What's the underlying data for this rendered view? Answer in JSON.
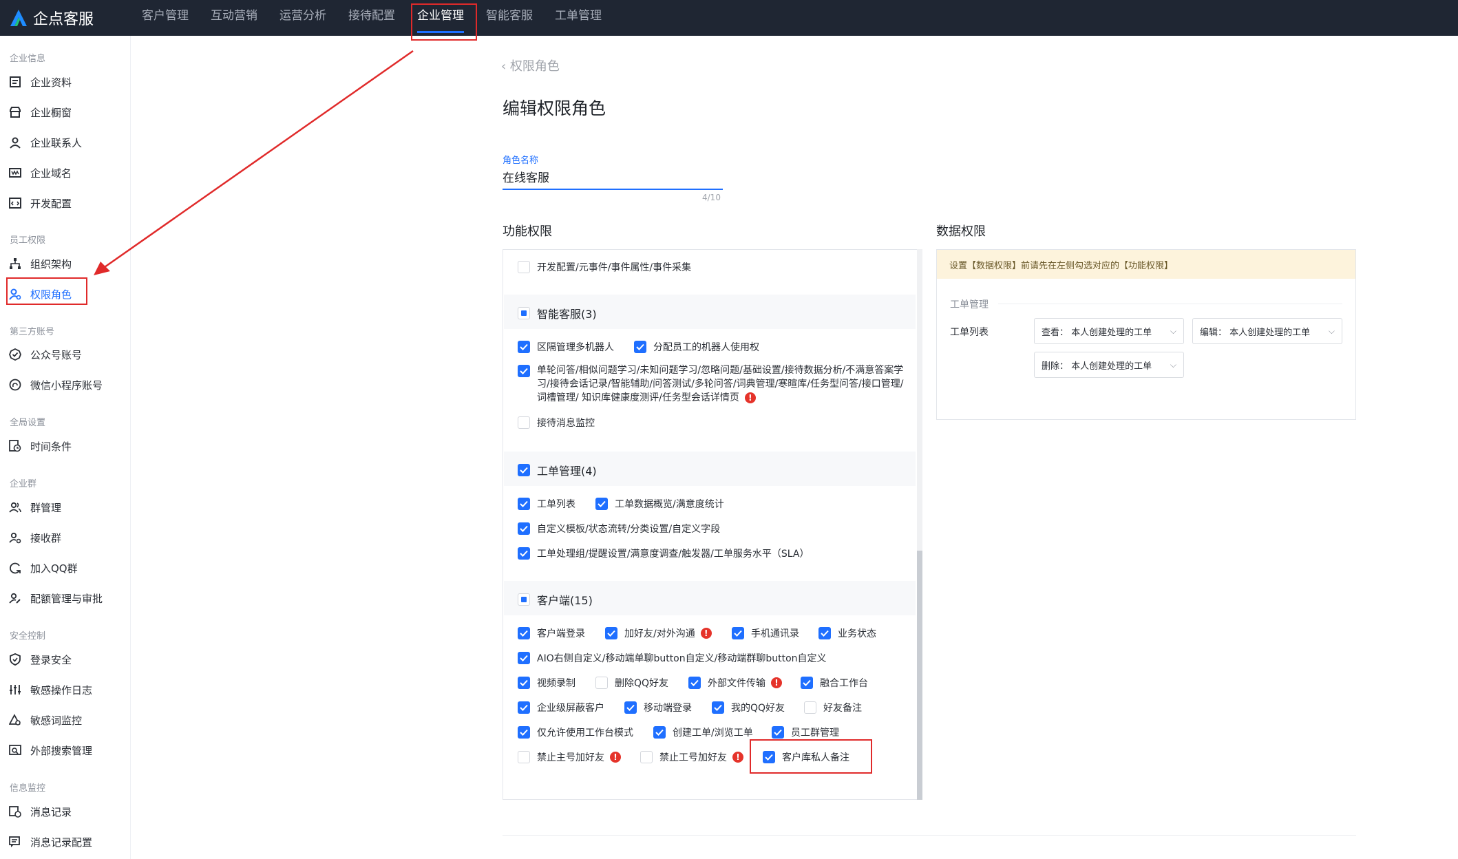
{
  "app": {
    "logo_text": "企点客服"
  },
  "nav": {
    "items": [
      "客户管理",
      "互动营销",
      "运营分析",
      "接待配置",
      "企业管理",
      "智能客服",
      "工单管理"
    ],
    "active_index": 4
  },
  "sidebar": {
    "groups": [
      {
        "title": "企业信息",
        "items": [
          "企业资料",
          "企业橱窗",
          "企业联系人",
          "企业域名",
          "开发配置"
        ]
      },
      {
        "title": "员工权限",
        "items": [
          "组织架构",
          "权限角色"
        ]
      },
      {
        "title": "第三方账号",
        "items": [
          "公众号账号",
          "微信小程序账号"
        ]
      },
      {
        "title": "全局设置",
        "items": [
          "时间条件"
        ]
      },
      {
        "title": "企业群",
        "items": [
          "群管理",
          "接收群",
          "加入QQ群",
          "配额管理与审批"
        ]
      },
      {
        "title": "安全控制",
        "items": [
          "登录安全",
          "敏感操作日志",
          "敏感词监控",
          "外部搜索管理"
        ]
      },
      {
        "title": "信息监控",
        "items": [
          "消息记录",
          "消息记录配置"
        ]
      }
    ],
    "active": "权限角色"
  },
  "page": {
    "back": "权限角色",
    "title": "编辑权限角色",
    "role_label": "角色名称",
    "role_value": "在线客服",
    "role_count": "4/10"
  },
  "func": {
    "title": "功能权限",
    "dev_item": "开发配置/元事件/事件属性/事件采集",
    "g1": {
      "label": "智能客服(3)",
      "items": [
        "区隔管理多机器人",
        "分配员工的机器人使用权"
      ],
      "long_text": "单轮问答/相似问题学习/未知问题学习/忽略问题/基础设置/接待数据分析/不满意答案学习/接待会话记录/智能辅助/问答测试/多轮问答/词典管理/寒暄库/任务型问答/接口管理/词槽管理/ 知识库健康度测评/任务型会话详情页",
      "monitor": "接待消息监控"
    },
    "g2": {
      "label": "工单管理(4)",
      "items": [
        "工单列表",
        "工单数据概览/满意度统计",
        "自定义模板/状态流转/分类设置/自定义字段",
        "工单处理组/提醒设置/满意度调查/触发器/工单服务水平（SLA）"
      ]
    },
    "g3": {
      "label": "客户端(15)",
      "items": [
        "客户端登录",
        "加好友/对外沟通",
        "手机通讯录",
        "业务状态",
        "AIO右侧自定义/移动端单聊button自定义/移动端群聊button自定义",
        "视频录制",
        "删除QQ好友",
        "外部文件传输",
        "融合工作台",
        "企业级屏蔽客户",
        "移动端登录",
        "我的QQ好友",
        "好友备注",
        "仅允许使用工作台模式",
        "创建工单/浏览工单",
        "员工群管理",
        "禁止主号加好友",
        "禁止工号加好友",
        "客户库私人备注"
      ]
    }
  },
  "data_perm": {
    "title": "数据权限",
    "notice": "设置【数据权限】前请先在左侧勾选对应的【功能权限】",
    "sub_title": "工单管理",
    "row_label": "工单列表",
    "view": "查看：  本人创建处理的工单",
    "edit": "编辑：  本人创建处理的工单",
    "delete": "删除：  本人创建处理的工单"
  },
  "colors": {
    "primary": "#1f6fff",
    "topbar": "#1f2633",
    "highlight": "#e02a2a",
    "warn": "#e5332a"
  }
}
